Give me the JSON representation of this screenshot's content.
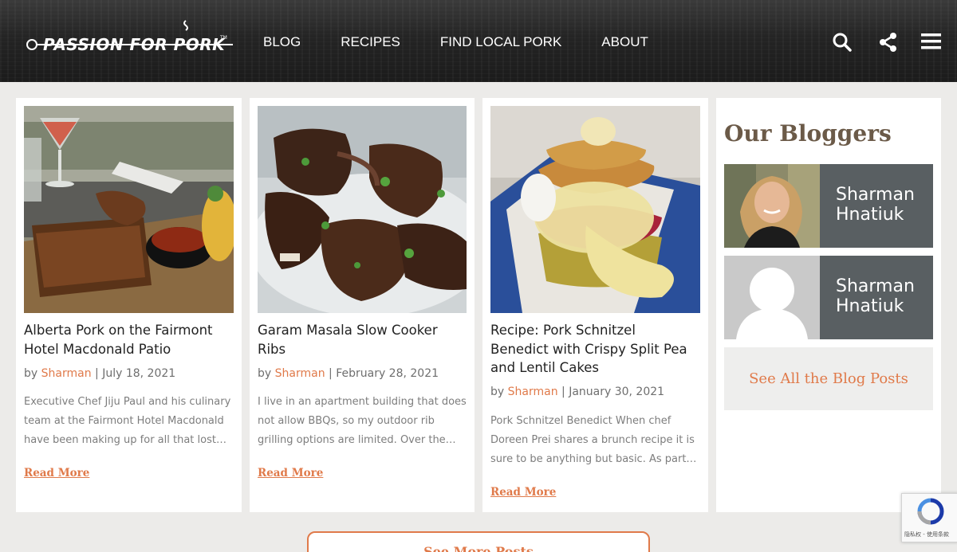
{
  "header": {
    "logo_text": "PASSION FOR PORK",
    "logo_tm": "TM",
    "nav": [
      "BLOG",
      "RECIPES",
      "FIND LOCAL PORK",
      "ABOUT"
    ],
    "icons": [
      "search-icon",
      "share-icon",
      "menu-icon"
    ]
  },
  "posts": [
    {
      "title": "Alberta Pork on the Fairmont Hotel Macdonald Patio",
      "by": "by ",
      "author": "Sharman",
      "date": " | July 18, 2021",
      "excerpt": "Executive Chef Jiju Paul and his culinary team at the Fairmont Hotel Macdonald have been making up for all that lost…",
      "read_more": "Read More"
    },
    {
      "title": "Garam Masala Slow Cooker Ribs",
      "by": "by ",
      "author": "Sharman",
      "date": " | February 28, 2021",
      "excerpt": "I live in an apartment building that does not allow BBQs, so my outdoor rib grilling options are limited. Over the…",
      "read_more": "Read More"
    },
    {
      "title": "Recipe: Pork Schnitzel Benedict with Crispy Split Pea and Lentil Cakes",
      "by": "by ",
      "author": "Sharman",
      "date": " | January 30, 2021",
      "excerpt": "Pork Schnitzel Benedict When chef Doreen Prei shares a brunch recipe it is sure to be anything but basic. As part…",
      "read_more": "Read More"
    }
  ],
  "sidebar": {
    "heading": "Our Bloggers",
    "bloggers": [
      {
        "name": "Sharman Hnatiuk"
      },
      {
        "name": "Sharman Hnatiuk"
      }
    ],
    "see_all": "See All the Blog Posts"
  },
  "see_more": "See More Posts",
  "recaptcha_label": "隐私权 - 使用条款",
  "colors": {
    "accent": "#e07a4a",
    "heading_brown": "#6b5a48",
    "blogger_bg": "#595f62"
  }
}
